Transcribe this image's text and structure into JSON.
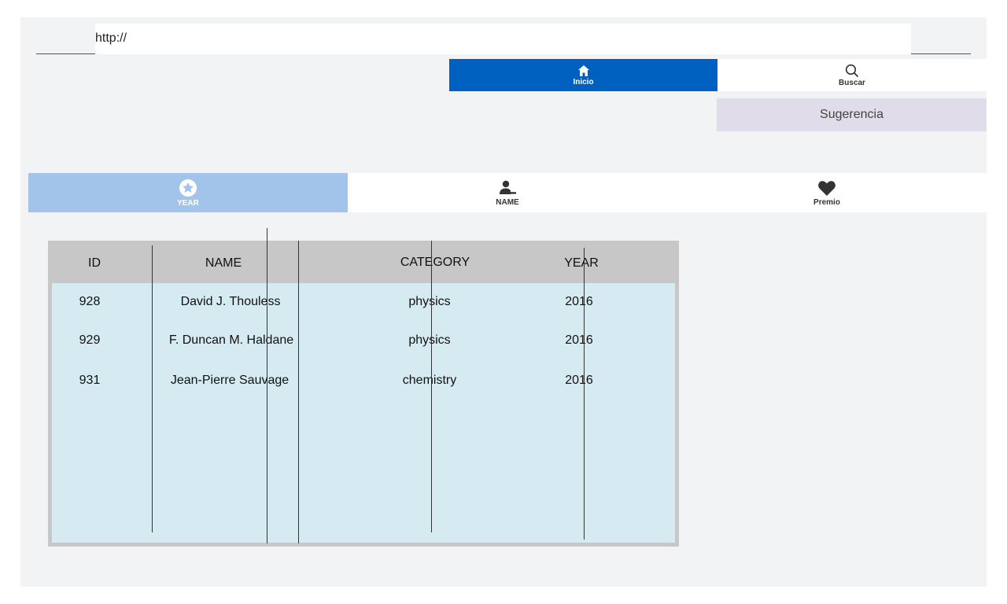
{
  "address_bar": {
    "value": "http://"
  },
  "nav": {
    "home_label": "Inicio",
    "home_icon": "home-icon",
    "search_label": "Buscar",
    "search_icon": "search-icon"
  },
  "suggestion_button": {
    "label": "Sugerencia"
  },
  "tabs": [
    {
      "label": "YEAR",
      "icon": "star-icon",
      "active": true
    },
    {
      "label": "NAME",
      "icon": "user-icon",
      "active": false
    },
    {
      "label": "Premio",
      "icon": "heart-icon",
      "active": false
    }
  ],
  "table": {
    "columns": [
      "ID",
      "NAME",
      "CATEGORY",
      "YEAR"
    ],
    "rows": [
      [
        "928",
        "David J. Thouless",
        "physics",
        "2016"
      ],
      [
        "929",
        "F. Duncan M. Haldane",
        "physics",
        "2016"
      ],
      [
        "931",
        "Jean-Pierre Sauvage",
        "chemistry",
        "2016"
      ]
    ]
  },
  "colors": {
    "active_nav": "#0060c0",
    "active_tab": "#a2c4ea",
    "suggestion_bg": "#e1dcea",
    "table_body": "#d6eaf1",
    "table_header": "#c7c7c7"
  }
}
